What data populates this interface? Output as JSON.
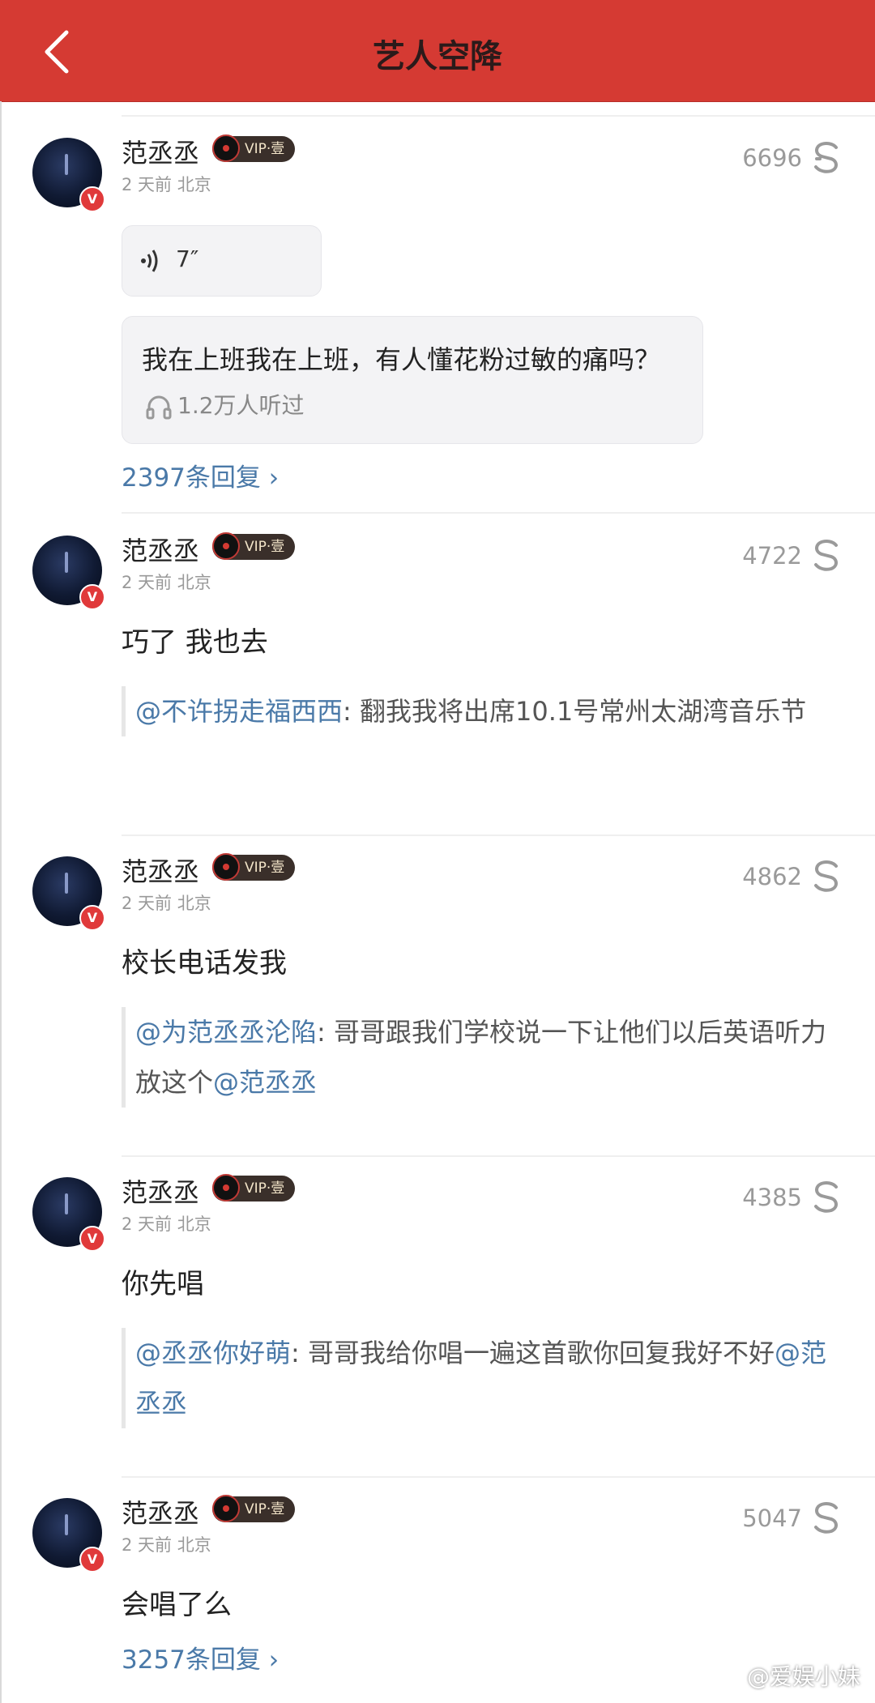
{
  "header": {
    "title": "艺人空降"
  },
  "comments": [
    {
      "user": "范丞丞",
      "vip": "VIP·壹",
      "meta": "2 天前 北京",
      "likes": "6696",
      "voice": {
        "duration": "7″",
        "text": "我在上班我在上班，有人懂花粉过敏的痛吗？",
        "listened": "1.2万人听过"
      },
      "replies": "2397条回复"
    },
    {
      "user": "范丞丞",
      "vip": "VIP·壹",
      "meta": "2 天前 北京",
      "likes": "4722",
      "text": "巧了 我也去",
      "quote": {
        "mention": "@不许拐走福西西",
        "text": ": 翻我我将出席10.1号常州太湖湾音乐节"
      }
    },
    {
      "user": "范丞丞",
      "vip": "VIP·壹",
      "meta": "2 天前 北京",
      "likes": "4862",
      "text": "校长电话发我",
      "quote": {
        "mention": "@为范丞丞沦陷",
        "text": ": 哥哥跟我们学校说一下让他们以后英语听力放这个",
        "mention2": "@范丞丞"
      }
    },
    {
      "user": "范丞丞",
      "vip": "VIP·壹",
      "meta": "2 天前 北京",
      "likes": "4385",
      "text": "你先唱",
      "quote": {
        "mention": "@丞丞你好萌",
        "text": ": 哥哥我给你唱一遍这首歌你回复我好不好",
        "mention2": "@范丞丞"
      }
    },
    {
      "user": "范丞丞",
      "vip": "VIP·壹",
      "meta": "2 天前 北京",
      "likes": "5047",
      "text": "会唱了么",
      "replies": "3257条回复"
    }
  ],
  "watermark": "@爱娱小妹",
  "colors": {
    "header": "#d53a33",
    "link": "#4a79a8",
    "vbadge": "#e0393a"
  },
  "icons": {
    "back": "chevron-left-icon",
    "like": "s-like-icon",
    "voice": "sound-wave-icon",
    "headphones": "headphones-icon"
  }
}
